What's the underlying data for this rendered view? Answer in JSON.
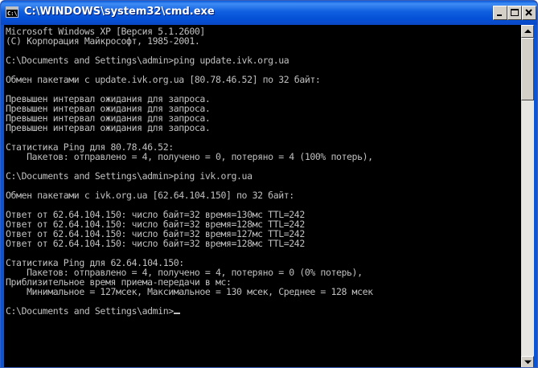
{
  "window": {
    "title": "C:\\WINDOWS\\system32\\cmd.exe",
    "icon_text": "C:\\"
  },
  "console": {
    "lines": [
      "Microsoft Windows XP [Версия 5.1.2600]",
      "(С) Корпорация Майкрософт, 1985-2001.",
      "",
      "C:\\Documents and Settings\\admin>ping update.ivk.org.ua",
      "",
      "Обмен пакетами с update.ivk.org.ua [80.78.46.52] по 32 байт:",
      "",
      "Превышен интервал ожидания для запроса.",
      "Превышен интервал ожидания для запроса.",
      "Превышен интервал ожидания для запроса.",
      "Превышен интервал ожидания для запроса.",
      "",
      "Статистика Ping для 80.78.46.52:",
      "    Пакетов: отправлено = 4, получено = 0, потеряно = 4 (100% потерь),",
      "",
      "C:\\Documents and Settings\\admin>ping ivk.org.ua",
      "",
      "Обмен пакетами с ivk.org.ua [62.64.104.150] по 32 байт:",
      "",
      "Ответ от 62.64.104.150: число байт=32 время=130мс TTL=242",
      "Ответ от 62.64.104.150: число байт=32 время=128мс TTL=242",
      "Ответ от 62.64.104.150: число байт=32 время=127мс TTL=242",
      "Ответ от 62.64.104.150: число байт=32 время=128мс TTL=242",
      "",
      "Статистика Ping для 62.64.104.150:",
      "    Пакетов: отправлено = 4, получено = 4, потеряно = 0 (0% потерь),",
      "Приблизительное время приема-передачи в мс:",
      "    Минимальное = 127мсек, Максимальное = 130 мсек, Среднее = 128 мсек",
      ""
    ],
    "prompt": "C:\\Documents and Settings\\admin>"
  },
  "colors": {
    "console_bg": "#000000",
    "console_text": "#c0c0c0",
    "titlebar": "#0a54d8"
  }
}
